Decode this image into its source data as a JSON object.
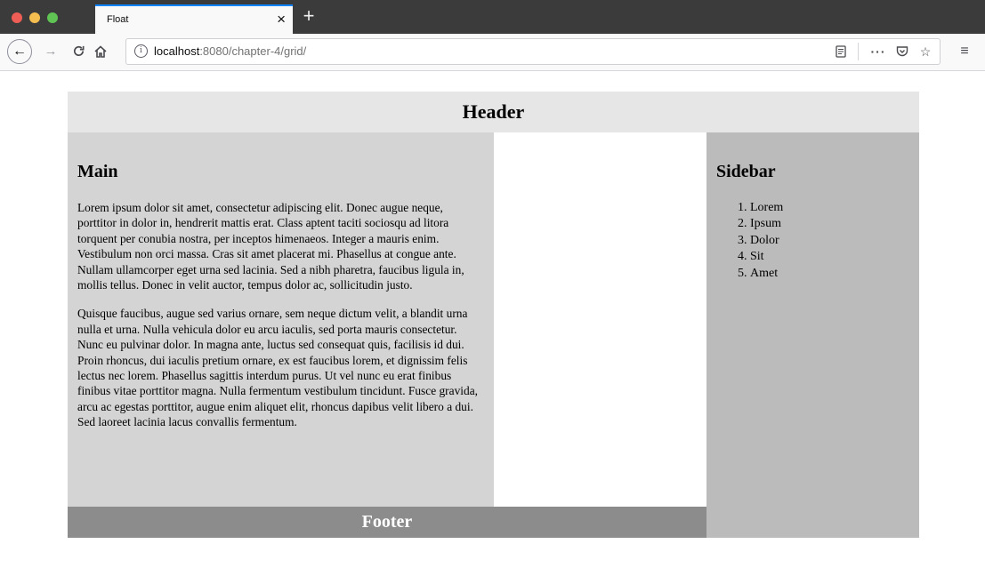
{
  "browser": {
    "tab_title": "Float",
    "tab_close": "×",
    "new_tab": "+",
    "url_host": "localhost",
    "url_rest": ":8080/chapter-4/grid/",
    "icons": {
      "back": "arrow-left-icon",
      "forward": "arrow-right-icon",
      "reload": "reload-icon",
      "home": "home-icon",
      "info": "info-icon",
      "reader": "reader-view-icon",
      "more": "more-icon",
      "pocket": "pocket-icon",
      "bookmark": "star-icon",
      "menu": "hamburger-menu-icon"
    }
  },
  "page": {
    "header": "Header",
    "main": {
      "title": "Main",
      "paragraphs": [
        "Lorem ipsum dolor sit amet, consectetur adipiscing elit. Donec augue neque, porttitor in dolor in, hendrerit mattis erat. Class aptent taciti sociosqu ad litora torquent per conubia nostra, per inceptos himenaeos. Integer a mauris enim. Vestibulum non orci massa. Cras sit amet placerat mi. Phasellus at congue ante. Nullam ullamcorper eget urna sed lacinia. Sed a nibh pharetra, faucibus ligula in, mollis tellus. Donec in velit auctor, tempus dolor ac, sollicitudin justo.",
        "Quisque faucibus, augue sed varius ornare, sem neque dictum velit, a blandit urna nulla et urna. Nulla vehicula dolor eu arcu iaculis, sed porta mauris consectetur. Nunc eu pulvinar dolor. In magna ante, luctus sed consequat quis, facilisis id dui. Proin rhoncus, dui iaculis pretium ornare, ex est faucibus lorem, et dignissim felis lectus nec lorem. Phasellus sagittis interdum purus. Ut vel nunc eu erat finibus finibus vitae porttitor magna. Nulla fermentum vestibulum tincidunt. Fusce gravida, arcu ac egestas porttitor, augue enim aliquet elit, rhoncus dapibus velit libero a dui. Sed laoreet lacinia lacus convallis fermentum."
      ]
    },
    "sidebar": {
      "title": "Sidebar",
      "items": [
        "Lorem",
        "Ipsum",
        "Dolor",
        "Sit",
        "Amet"
      ]
    },
    "footer": "Footer"
  },
  "colors": {
    "header_bg": "#e6e6e6",
    "main_bg": "#d4d4d4",
    "sidebar_bg": "#bbbbbb",
    "footer_bg": "#8c8c8c",
    "footer_text": "#ffffff",
    "tab_accent": "#0a84ff"
  }
}
